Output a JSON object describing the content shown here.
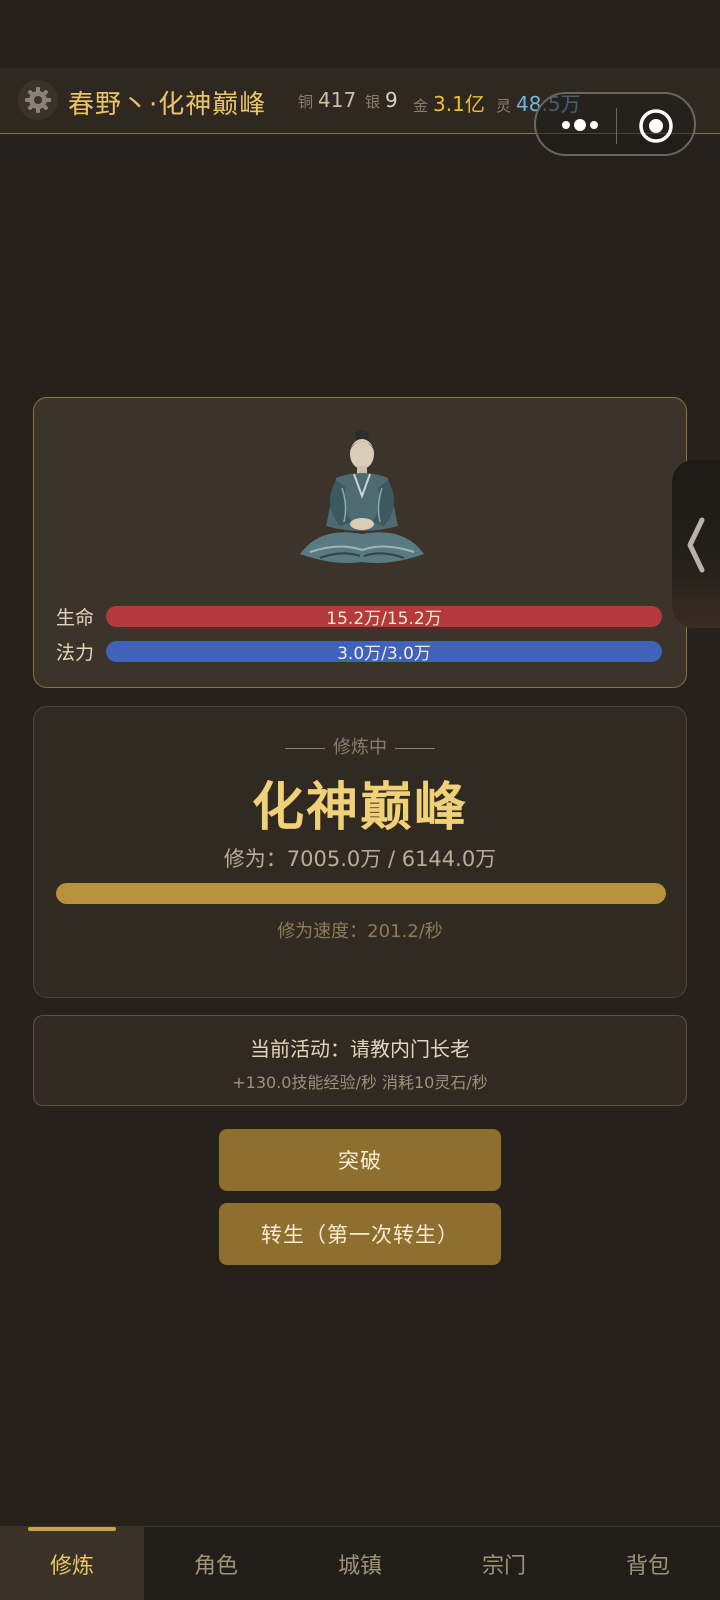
{
  "header": {
    "player_name": "春野丶·化神巅峰",
    "currencies": {
      "copper": {
        "label": "铜",
        "value": "417"
      },
      "silver": {
        "label": "银",
        "value": "9"
      },
      "gold": {
        "label": "金",
        "value": "3.1亿"
      },
      "spirit": {
        "label": "灵",
        "value": "48.5万"
      }
    },
    "icons": {
      "settings": "gear-icon",
      "more": "more-dots-icon",
      "close": "target-close-icon"
    }
  },
  "character": {
    "icon": "meditating-cultivator-avatar",
    "hp": {
      "label": "生命",
      "text": "15.2万/15.2万",
      "fraction": 1.0
    },
    "mp": {
      "label": "法力",
      "text": "3.0万/3.0万",
      "fraction": 1.0
    }
  },
  "side_tab": {
    "icon": "chevron-left-icon"
  },
  "cultivation": {
    "status": "修炼中",
    "realm": "化神巅峰",
    "xiuwei_text": "修为：7005.0万 / 6144.0万",
    "xiuwei_fraction": 1.0,
    "speed_text": "修为速度：201.2/秒"
  },
  "activity": {
    "title": "当前活动：请教内门长老",
    "detail": "+130.0技能经验/秒   消耗10灵石/秒"
  },
  "buttons": {
    "breakthrough": "突破",
    "rebirth": "转生（第一次转生）"
  },
  "nav": {
    "items": [
      {
        "label": "修炼",
        "active": true
      },
      {
        "label": "角色",
        "active": false
      },
      {
        "label": "城镇",
        "active": false
      },
      {
        "label": "宗门",
        "active": false
      },
      {
        "label": "背包",
        "active": false
      }
    ]
  },
  "colors": {
    "background": "#26211b",
    "accent_gold": "#e8c46a",
    "hp_bar": "#b53a3c",
    "mp_bar": "#3f63b8",
    "progress": "#b8923a",
    "button": "#8f6f2e",
    "spirit": "#6fb6e0"
  }
}
